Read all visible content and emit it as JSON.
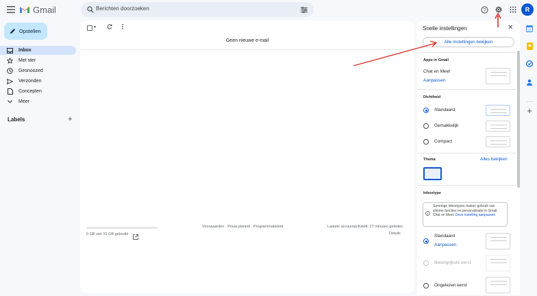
{
  "app": {
    "name": "Gmail",
    "avatar_letter": "R"
  },
  "search": {
    "placeholder": "Berichten doorzoeken"
  },
  "compose": {
    "label": "Opstellen"
  },
  "nav": {
    "items": [
      {
        "label": "Inbox",
        "icon": "inbox-icon"
      },
      {
        "label": "Met ster",
        "icon": "star-icon"
      },
      {
        "label": "Gesnoozed",
        "icon": "clock-icon"
      },
      {
        "label": "Verzonden",
        "icon": "send-icon"
      },
      {
        "label": "Concepten",
        "icon": "draft-icon"
      },
      {
        "label": "Meer",
        "icon": "chevron-down-icon"
      }
    ]
  },
  "labels": {
    "heading": "Labels"
  },
  "main": {
    "empty_message": "Geen nieuwe e-mail",
    "storage": "0 GB van 15 GB gebruikt",
    "storage_used_fraction": 0,
    "footer_links": "Voorwaarden · Privacybeleid · Programmabeleid",
    "activity": "Laatste accountactiviteit: 27 minuten geleden",
    "details": "Details"
  },
  "quick_settings": {
    "title": "Snelle instellingen",
    "all_settings": "Alle instellingen bekijken",
    "apps_title": "Apps in Gmail",
    "chat_meet": "Chat en Meet",
    "customize": "Aanpassen",
    "density_title": "Dichtheid",
    "density_options": [
      "Standaard",
      "Gemakkelijk",
      "Compact"
    ],
    "density_selected": "Standaard",
    "theme_title": "Thema",
    "theme_link": "Alles bekijken",
    "inbox_type_title": "Inboxtype",
    "inbox_info": "Sommige inboxtypen maken gebruik van slimme functies en personalisatie in Gmail, Chat en Meet.",
    "inbox_info_link": "Deze instelling aanpassen",
    "inbox_types": [
      "Standaard",
      "Belangrijkste eerst",
      "Ongelezen eerst"
    ],
    "inbox_customize": "Aanpassen"
  },
  "colors": {
    "accent": "#0b57d0",
    "compose_bg": "#c2e7ff",
    "active_nav": "#d3e3fd",
    "annotation": "#d93025"
  }
}
